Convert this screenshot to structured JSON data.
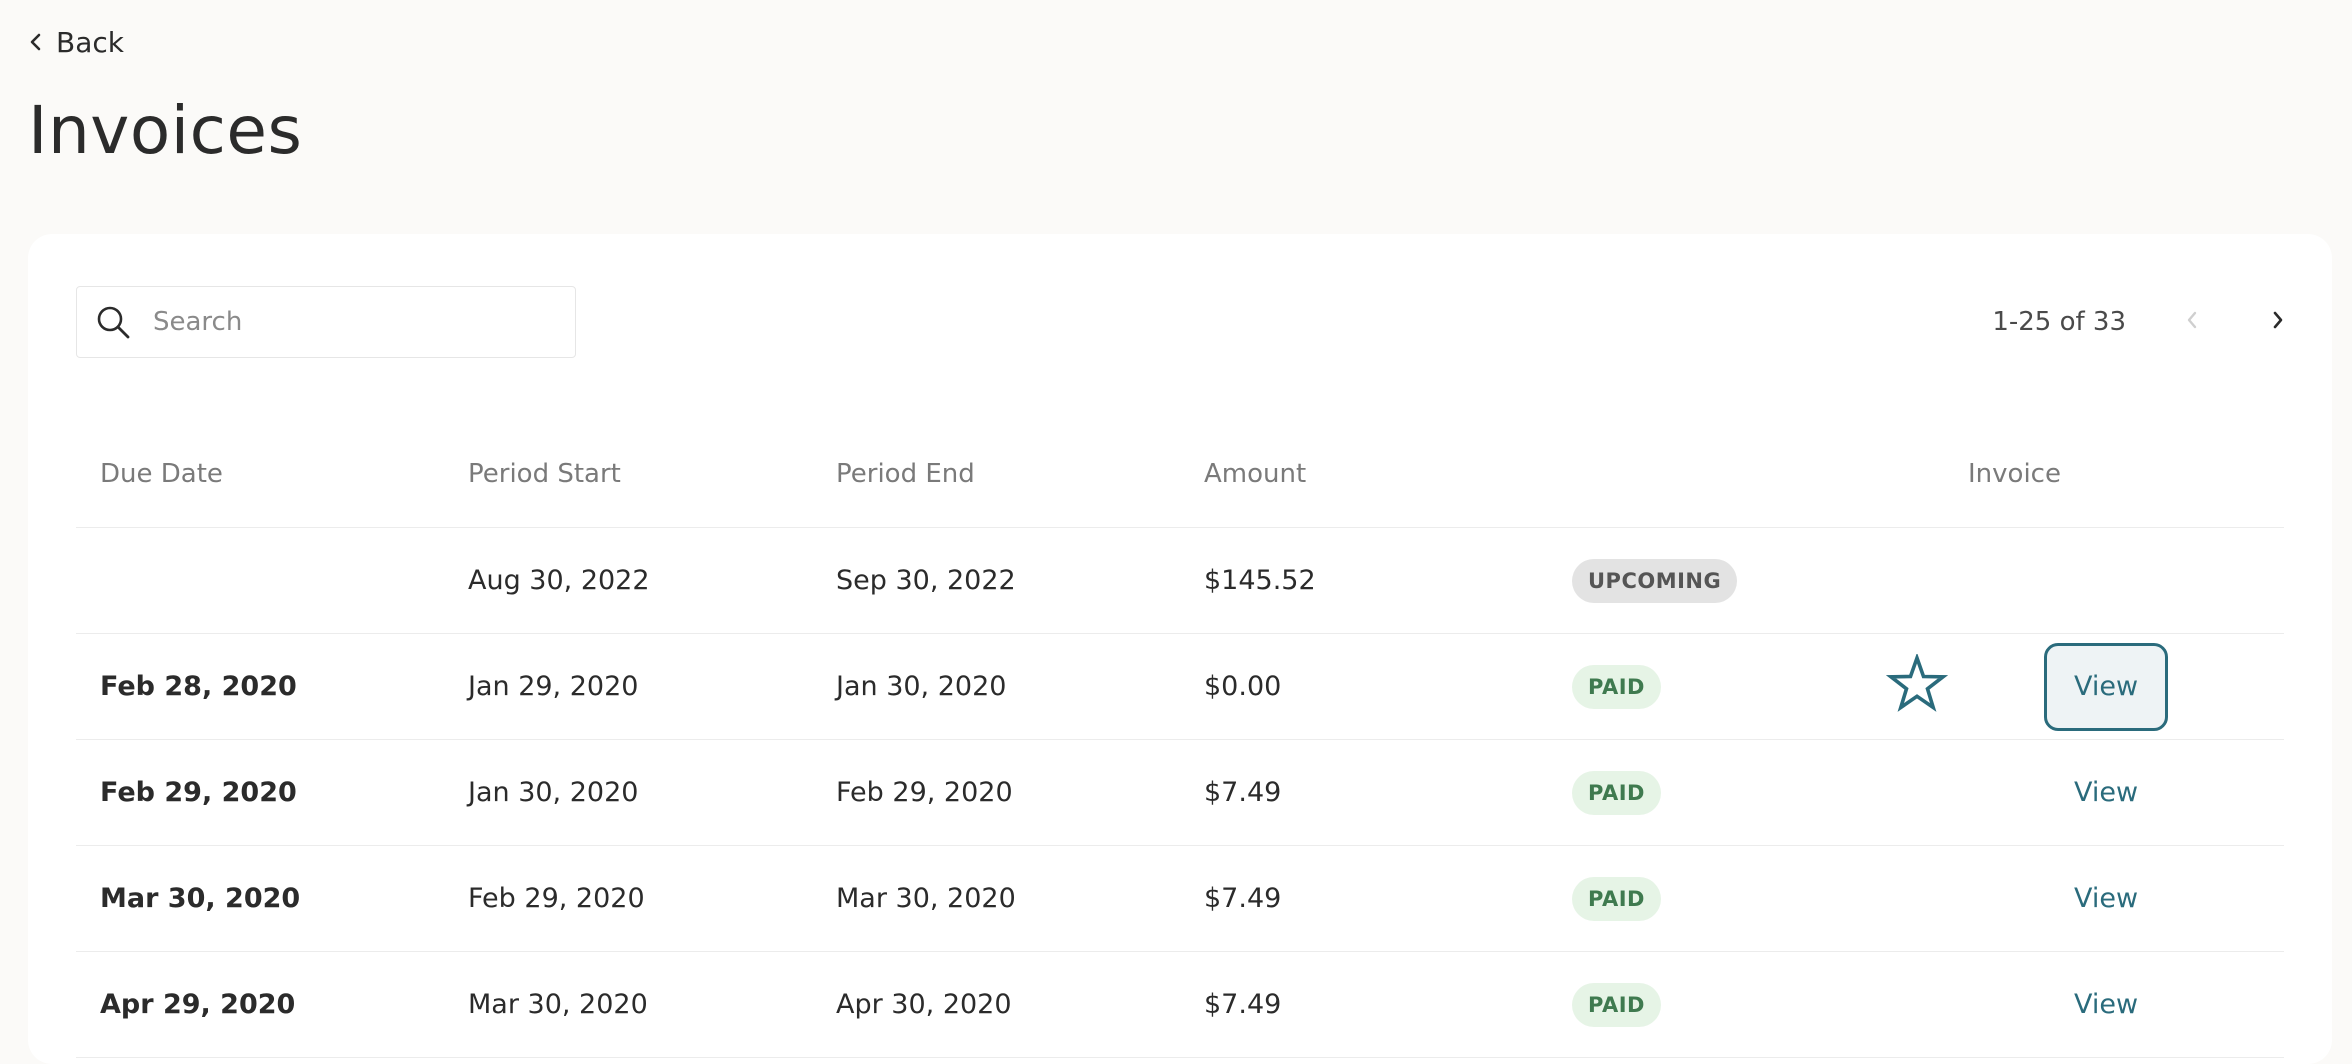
{
  "nav": {
    "back_label": "Back"
  },
  "page": {
    "title": "Invoices"
  },
  "search": {
    "placeholder": "Search",
    "value": ""
  },
  "pagination": {
    "range_label": "1-25 of 33"
  },
  "table": {
    "headers": {
      "due_date": "Due Date",
      "period_start": "Period Start",
      "period_end": "Period End",
      "amount": "Amount",
      "status": "",
      "invoice": "Invoice"
    },
    "rows": [
      {
        "due_date": "",
        "period_start": "Aug 30, 2022",
        "period_end": "Sep 30, 2022",
        "amount": "$145.52",
        "status": "UPCOMING",
        "invoice": ""
      },
      {
        "due_date": "Feb 28, 2020",
        "period_start": "Jan 29, 2020",
        "period_end": "Jan 30, 2020",
        "amount": "$0.00",
        "status": "PAID",
        "invoice": "View"
      },
      {
        "due_date": "Feb 29, 2020",
        "period_start": "Jan 30, 2020",
        "period_end": "Feb 29, 2020",
        "amount": "$7.49",
        "status": "PAID",
        "invoice": "View"
      },
      {
        "due_date": "Mar 30, 2020",
        "period_start": "Feb 29, 2020",
        "period_end": "Mar 30, 2020",
        "amount": "$7.49",
        "status": "PAID",
        "invoice": "View"
      },
      {
        "due_date": "Apr 29, 2020",
        "period_start": "Mar 30, 2020",
        "period_end": "Apr 30, 2020",
        "amount": "$7.49",
        "status": "PAID",
        "invoice": "View"
      }
    ]
  },
  "colors": {
    "page_bg": "#fbfaf8",
    "accent": "#2a6b7c",
    "paid_badge_bg": "#e6f4e6",
    "paid_badge_text": "#3f7a4f",
    "upcoming_badge_bg": "#e3e3e3"
  },
  "icons": {
    "back": "chevron-left-icon",
    "search": "search-icon",
    "prev_page": "chevron-left-icon",
    "next_page": "chevron-right-icon",
    "marker": "star-outline-icon"
  }
}
